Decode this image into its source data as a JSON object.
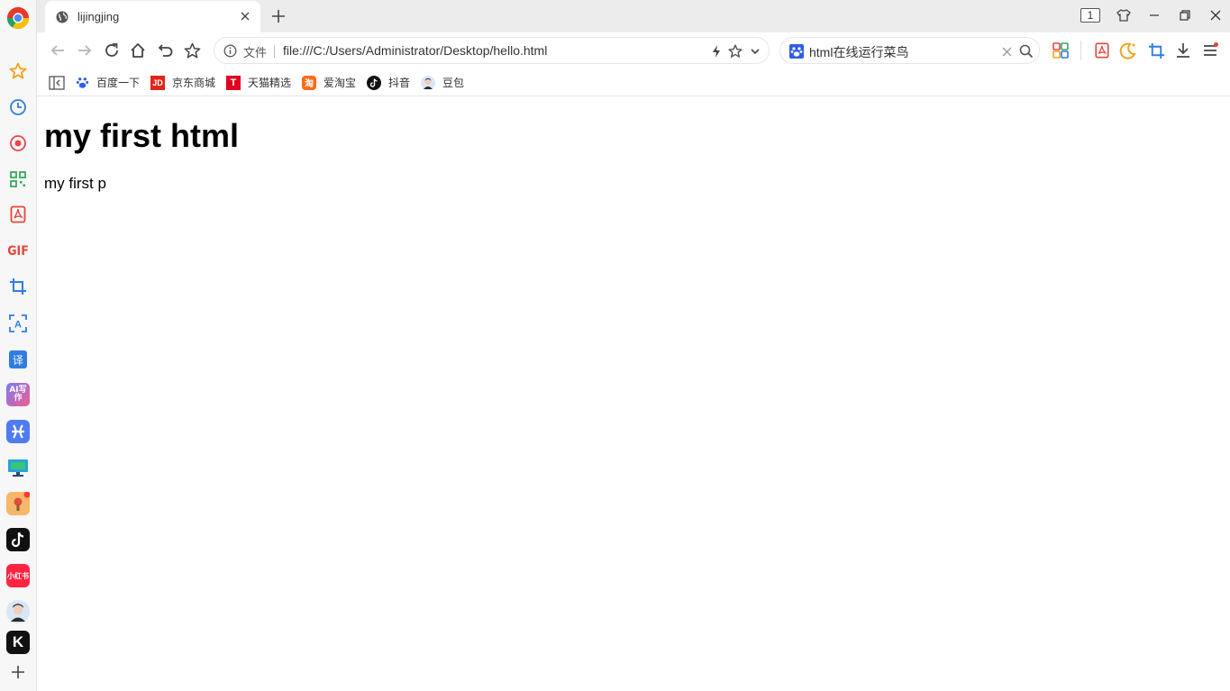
{
  "tab": {
    "title": "lijingjing"
  },
  "window": {
    "tab_count": "1"
  },
  "addressbar": {
    "scheme_label": "文件",
    "url": "file:///C:/Users/Administrator/Desktop/hello.html"
  },
  "searchbox": {
    "query": "html在线运行菜鸟"
  },
  "bookmarks": [
    {
      "label": "百度一下",
      "icon": "baidu-paw-icon"
    },
    {
      "label": "京东商城",
      "icon": "jd-icon"
    },
    {
      "label": "天猫精选",
      "icon": "tmall-icon"
    },
    {
      "label": "爱淘宝",
      "icon": "taobao-icon"
    },
    {
      "label": "抖音",
      "icon": "douyin-icon"
    },
    {
      "label": "豆包",
      "icon": "doubao-icon"
    }
  ],
  "sidebar": {
    "items": [
      {
        "name": "favorites-star-icon"
      },
      {
        "name": "history-clock-icon"
      },
      {
        "name": "record-icon"
      },
      {
        "name": "qrcode-icon"
      },
      {
        "name": "pdf-icon"
      },
      {
        "name": "gif",
        "label": "GIF"
      },
      {
        "name": "crop-icon"
      },
      {
        "name": "ocr-icon",
        "label": "A"
      },
      {
        "name": "translate-icon",
        "label": "译"
      },
      {
        "name": "ai-write-icon",
        "label": "AI写作"
      },
      {
        "name": "app-icon"
      },
      {
        "name": "monitor-icon"
      },
      {
        "name": "game-icon"
      },
      {
        "name": "douyin-icon"
      },
      {
        "name": "xiaohongshu-icon",
        "label": "小红书"
      },
      {
        "name": "avatar-icon"
      },
      {
        "name": "k-app-icon",
        "label": "K"
      },
      {
        "name": "add-icon"
      }
    ]
  },
  "page": {
    "heading": "my first html",
    "paragraph": "my first p"
  },
  "colors": {
    "accent": "#1a73e8",
    "tabstrip": "#ececec",
    "sidebar": "#f7f7f7",
    "red": "#e8382b"
  }
}
